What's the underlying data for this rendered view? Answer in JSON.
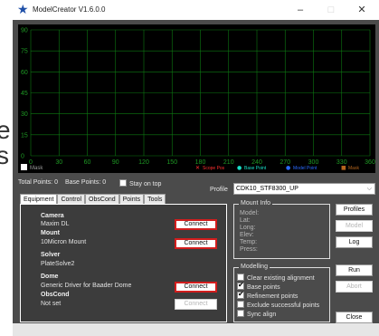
{
  "window": {
    "title": "ModelCreator V1.6.0.0",
    "minimize": "–",
    "maximize": "□",
    "close": "✕"
  },
  "bleed_text": [
    "e",
    "s"
  ],
  "plot": {
    "y_ticks": [
      "90",
      "75",
      "60",
      "45",
      "30",
      "15",
      "0"
    ],
    "x_ticks": [
      "0",
      "30",
      "60",
      "90",
      "120",
      "150",
      "180",
      "210",
      "240",
      "270",
      "300",
      "330",
      "360"
    ],
    "mask_label": "Mask",
    "legend": [
      {
        "label": "Scope Pos",
        "color": "#ff3030",
        "symbol": "✕"
      },
      {
        "label": "Base Point",
        "color": "#19e0c8",
        "symbol": "●"
      },
      {
        "label": "Model Point",
        "color": "#2a6bff",
        "symbol": "●"
      },
      {
        "label": "Mask",
        "color": "#b5651d",
        "symbol": "■"
      }
    ],
    "grid_color": "#0d7a12",
    "label_color": "#1e9a24"
  },
  "status": {
    "total_points": "Total Points: 0",
    "base_points": "Base Points: 0",
    "stay_on_top": "Stay on top"
  },
  "profile": {
    "label": "Profile",
    "value": "CDK10_STF8300_UP"
  },
  "tabs": [
    "Equipment",
    "Control",
    "ObsCond",
    "Points",
    "Tools"
  ],
  "equipment": {
    "camera_heading": "Camera",
    "camera_value": "Maxim DL",
    "mount_heading": "Mount",
    "mount_value": "10Micron Mount",
    "solver_heading": "Solver",
    "solver_value": "PlateSolve2",
    "dome_heading": "Dome",
    "dome_value": "Generic Driver for Baader Dome",
    "obscond_heading": "ObsCond",
    "obscond_value": "Not set",
    "connect": "Connect"
  },
  "mount_info": {
    "title": "Mount Info",
    "lines": [
      "Model:",
      "Lat:",
      "Long:",
      "Elev:",
      "Temp:",
      "Press:"
    ]
  },
  "modelling": {
    "title": "Modelling",
    "options": [
      {
        "label": "Clear existing alignment",
        "checked": false
      },
      {
        "label": "Base points",
        "checked": true
      },
      {
        "label": "Refinement points",
        "checked": true
      },
      {
        "label": "Exclude successful points",
        "checked": false
      },
      {
        "label": "Sync align",
        "checked": false
      }
    ]
  },
  "right_buttons": {
    "profiles": "Profiles",
    "model": "Model",
    "log": "Log",
    "run": "Run",
    "abort": "Abort",
    "close": "Close"
  }
}
